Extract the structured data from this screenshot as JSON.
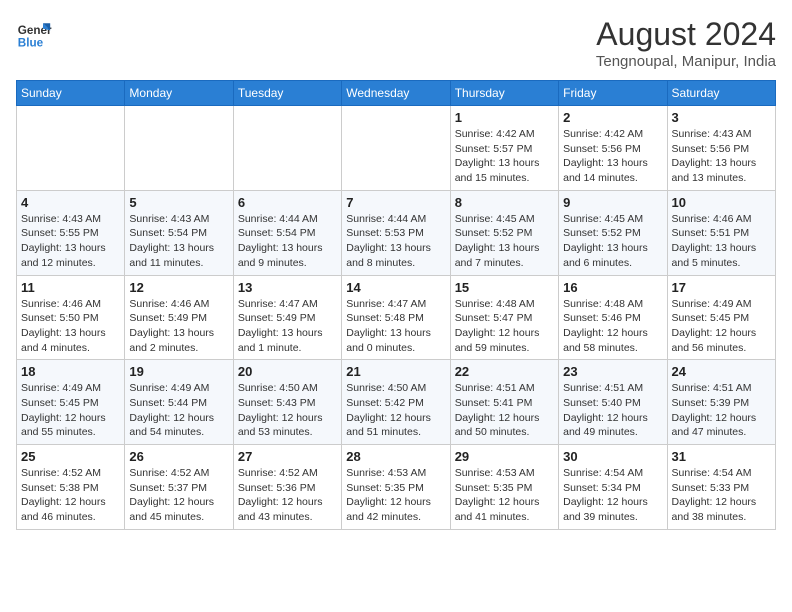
{
  "header": {
    "logo_line1": "General",
    "logo_line2": "Blue",
    "main_title": "August 2024",
    "subtitle": "Tengnoupal, Manipur, India"
  },
  "days_of_week": [
    "Sunday",
    "Monday",
    "Tuesday",
    "Wednesday",
    "Thursday",
    "Friday",
    "Saturday"
  ],
  "weeks": [
    [
      {
        "day": "",
        "info": ""
      },
      {
        "day": "",
        "info": ""
      },
      {
        "day": "",
        "info": ""
      },
      {
        "day": "",
        "info": ""
      },
      {
        "day": "1",
        "info": "Sunrise: 4:42 AM\nSunset: 5:57 PM\nDaylight: 13 hours\nand 15 minutes."
      },
      {
        "day": "2",
        "info": "Sunrise: 4:42 AM\nSunset: 5:56 PM\nDaylight: 13 hours\nand 14 minutes."
      },
      {
        "day": "3",
        "info": "Sunrise: 4:43 AM\nSunset: 5:56 PM\nDaylight: 13 hours\nand 13 minutes."
      }
    ],
    [
      {
        "day": "4",
        "info": "Sunrise: 4:43 AM\nSunset: 5:55 PM\nDaylight: 13 hours\nand 12 minutes."
      },
      {
        "day": "5",
        "info": "Sunrise: 4:43 AM\nSunset: 5:54 PM\nDaylight: 13 hours\nand 11 minutes."
      },
      {
        "day": "6",
        "info": "Sunrise: 4:44 AM\nSunset: 5:54 PM\nDaylight: 13 hours\nand 9 minutes."
      },
      {
        "day": "7",
        "info": "Sunrise: 4:44 AM\nSunset: 5:53 PM\nDaylight: 13 hours\nand 8 minutes."
      },
      {
        "day": "8",
        "info": "Sunrise: 4:45 AM\nSunset: 5:52 PM\nDaylight: 13 hours\nand 7 minutes."
      },
      {
        "day": "9",
        "info": "Sunrise: 4:45 AM\nSunset: 5:52 PM\nDaylight: 13 hours\nand 6 minutes."
      },
      {
        "day": "10",
        "info": "Sunrise: 4:46 AM\nSunset: 5:51 PM\nDaylight: 13 hours\nand 5 minutes."
      }
    ],
    [
      {
        "day": "11",
        "info": "Sunrise: 4:46 AM\nSunset: 5:50 PM\nDaylight: 13 hours\nand 4 minutes."
      },
      {
        "day": "12",
        "info": "Sunrise: 4:46 AM\nSunset: 5:49 PM\nDaylight: 13 hours\nand 2 minutes."
      },
      {
        "day": "13",
        "info": "Sunrise: 4:47 AM\nSunset: 5:49 PM\nDaylight: 13 hours\nand 1 minute."
      },
      {
        "day": "14",
        "info": "Sunrise: 4:47 AM\nSunset: 5:48 PM\nDaylight: 13 hours\nand 0 minutes."
      },
      {
        "day": "15",
        "info": "Sunrise: 4:48 AM\nSunset: 5:47 PM\nDaylight: 12 hours\nand 59 minutes."
      },
      {
        "day": "16",
        "info": "Sunrise: 4:48 AM\nSunset: 5:46 PM\nDaylight: 12 hours\nand 58 minutes."
      },
      {
        "day": "17",
        "info": "Sunrise: 4:49 AM\nSunset: 5:45 PM\nDaylight: 12 hours\nand 56 minutes."
      }
    ],
    [
      {
        "day": "18",
        "info": "Sunrise: 4:49 AM\nSunset: 5:45 PM\nDaylight: 12 hours\nand 55 minutes."
      },
      {
        "day": "19",
        "info": "Sunrise: 4:49 AM\nSunset: 5:44 PM\nDaylight: 12 hours\nand 54 minutes."
      },
      {
        "day": "20",
        "info": "Sunrise: 4:50 AM\nSunset: 5:43 PM\nDaylight: 12 hours\nand 53 minutes."
      },
      {
        "day": "21",
        "info": "Sunrise: 4:50 AM\nSunset: 5:42 PM\nDaylight: 12 hours\nand 51 minutes."
      },
      {
        "day": "22",
        "info": "Sunrise: 4:51 AM\nSunset: 5:41 PM\nDaylight: 12 hours\nand 50 minutes."
      },
      {
        "day": "23",
        "info": "Sunrise: 4:51 AM\nSunset: 5:40 PM\nDaylight: 12 hours\nand 49 minutes."
      },
      {
        "day": "24",
        "info": "Sunrise: 4:51 AM\nSunset: 5:39 PM\nDaylight: 12 hours\nand 47 minutes."
      }
    ],
    [
      {
        "day": "25",
        "info": "Sunrise: 4:52 AM\nSunset: 5:38 PM\nDaylight: 12 hours\nand 46 minutes."
      },
      {
        "day": "26",
        "info": "Sunrise: 4:52 AM\nSunset: 5:37 PM\nDaylight: 12 hours\nand 45 minutes."
      },
      {
        "day": "27",
        "info": "Sunrise: 4:52 AM\nSunset: 5:36 PM\nDaylight: 12 hours\nand 43 minutes."
      },
      {
        "day": "28",
        "info": "Sunrise: 4:53 AM\nSunset: 5:35 PM\nDaylight: 12 hours\nand 42 minutes."
      },
      {
        "day": "29",
        "info": "Sunrise: 4:53 AM\nSunset: 5:35 PM\nDaylight: 12 hours\nand 41 minutes."
      },
      {
        "day": "30",
        "info": "Sunrise: 4:54 AM\nSunset: 5:34 PM\nDaylight: 12 hours\nand 39 minutes."
      },
      {
        "day": "31",
        "info": "Sunrise: 4:54 AM\nSunset: 5:33 PM\nDaylight: 12 hours\nand 38 minutes."
      }
    ]
  ]
}
